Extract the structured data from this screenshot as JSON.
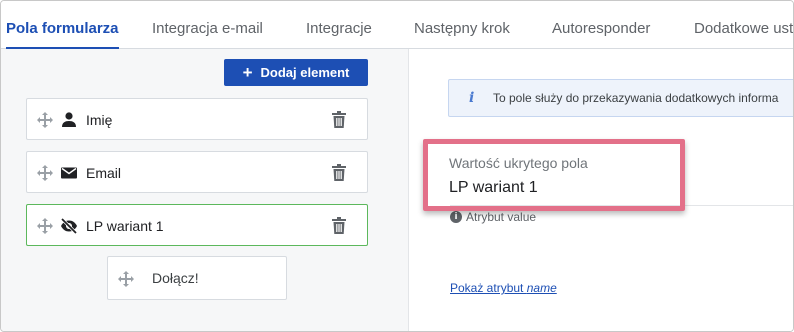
{
  "tabs": [
    {
      "label": "Pola formularza",
      "active": true
    },
    {
      "label": "Integracja e-mail"
    },
    {
      "label": "Integracje"
    },
    {
      "label": "Następny krok"
    },
    {
      "label": "Autoresponder"
    },
    {
      "label": "Dodatkowe ust"
    }
  ],
  "left_panel": {
    "add_button_icon": "+",
    "add_button_label": "Dodaj element",
    "fields": [
      {
        "label": "Imię",
        "icon": "person-icon"
      },
      {
        "label": "Email",
        "icon": "envelope-icon"
      },
      {
        "label": "LP wariant 1",
        "icon": "eye-slash-icon",
        "selected": true
      }
    ],
    "join_button_label": "Dołącz!"
  },
  "right_panel": {
    "info_icon": "i",
    "info_text": "To pole służy do przekazywania dodatkowych informa",
    "hidden_field_label": "Wartość ukrytego pola",
    "hidden_field_value": "LP wariant 1",
    "attr_note_icon": "i",
    "attr_note": "Atrybut value",
    "show_attr_prefix": "Pokaż atrybut ",
    "show_attr_em": "name"
  },
  "colors": {
    "accent": "#1d4fb4",
    "selected_border": "#5cb85c",
    "highlight": "#e37089"
  }
}
